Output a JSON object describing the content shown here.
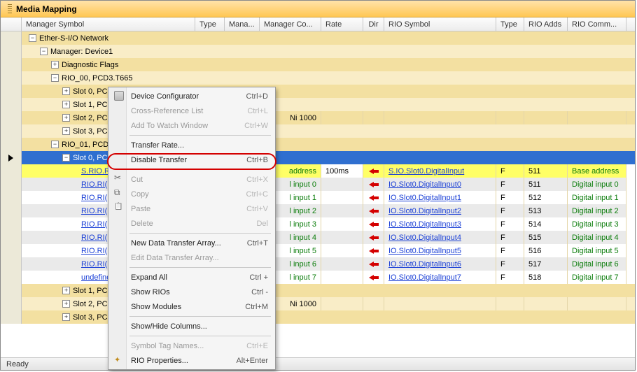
{
  "window": {
    "title": "Media Mapping"
  },
  "status": {
    "text": "Ready"
  },
  "columns": {
    "symbol": "Manager Symbol",
    "type": "Type",
    "mana": "Mana...",
    "mcomment": "Manager Co...",
    "rate": "Rate",
    "dir": "Dir",
    "rsymbol": "RIO Symbol",
    "rtype": "Type",
    "radds": "RIO Adds",
    "rcomment": "RIO Comm..."
  },
  "tree": {
    "root": "Ether-S-I/O Network",
    "manager": "Manager: Device1",
    "diag": "Diagnostic Flags",
    "rio00": "RIO_00, PCD3.T665",
    "rio00_slots": [
      "Slot 0, PCD3",
      "Slot 1, PCD3",
      "Slot 2, PCD3",
      "Slot 3, PCD3"
    ],
    "rio01": "RIO_01, PCD3",
    "rio01_slot0": "Slot 0, PCD3",
    "rio01_sub": [
      "S.RIO.RI(",
      "RIO.RI(",
      "RIO.RI(",
      "RIO.RI(",
      "RIO.RI(",
      "RIO.RI(",
      "RIO.RI(",
      "RIO.RI("
    ],
    "rio01_slots_rest": [
      "Slot 1, PCD3",
      "Slot 2, PCD3",
      "Slot 3, PCD3"
    ],
    "slot2_extra": "Ni 1000",
    "slot2_extra2": "Ni 1000"
  },
  "mapping": {
    "base": {
      "mcomment": "address",
      "rate": "100ms",
      "rsymbol": "S.IO.Slot0.DigitalInput",
      "rtype": "F",
      "radds": "511",
      "rcomment": "Base address"
    },
    "rows": [
      {
        "mcomment": "l input 0",
        "rsymbol": "IO.Slot0.DigitalInput0",
        "rtype": "F",
        "radds": "511",
        "rcomment": "Digital input 0"
      },
      {
        "mcomment": "l input 1",
        "rsymbol": "IO.Slot0.DigitalInput1",
        "rtype": "F",
        "radds": "512",
        "rcomment": "Digital input 1"
      },
      {
        "mcomment": "l input 2",
        "rsymbol": "IO.Slot0.DigitalInput2",
        "rtype": "F",
        "radds": "513",
        "rcomment": "Digital input 2"
      },
      {
        "mcomment": "l input 3",
        "rsymbol": "IO.Slot0.DigitalInput3",
        "rtype": "F",
        "radds": "514",
        "rcomment": "Digital input 3"
      },
      {
        "mcomment": "l input 4",
        "rsymbol": "IO.Slot0.DigitalInput4",
        "rtype": "F",
        "radds": "515",
        "rcomment": "Digital input 4"
      },
      {
        "mcomment": "l input 5",
        "rsymbol": "IO.Slot0.DigitalInput5",
        "rtype": "F",
        "radds": "516",
        "rcomment": "Digital input 5"
      },
      {
        "mcomment": "l input 6",
        "rsymbol": "IO.Slot0.DigitalInput6",
        "rtype": "F",
        "radds": "517",
        "rcomment": "Digital input 6"
      },
      {
        "mcomment": "l input 7",
        "rsymbol": "IO.Slot0.DigitalInput7",
        "rtype": "F",
        "radds": "518",
        "rcomment": "Digital input 7"
      }
    ]
  },
  "menu": {
    "items": [
      {
        "label": "Device Configurator",
        "shortcut": "Ctrl+D",
        "icon": "wrench"
      },
      {
        "label": "Cross-Reference List",
        "shortcut": "Ctrl+L",
        "disabled": true
      },
      {
        "label": "Add To Watch Window",
        "shortcut": "Ctrl+W",
        "disabled": true
      },
      {
        "sep": true
      },
      {
        "label": "Transfer Rate..."
      },
      {
        "label": "Disable Transfer",
        "shortcut": "Ctrl+B"
      },
      {
        "sep": true
      },
      {
        "label": "Cut",
        "shortcut": "Ctrl+X",
        "icon": "scis",
        "disabled": true
      },
      {
        "label": "Copy",
        "shortcut": "Ctrl+C",
        "icon": "copy",
        "disabled": true
      },
      {
        "label": "Paste",
        "shortcut": "Ctrl+V",
        "icon": "paste",
        "disabled": true
      },
      {
        "label": "Delete",
        "shortcut": "Del",
        "disabled": true
      },
      {
        "sep": true
      },
      {
        "label": "New Data Transfer Array...",
        "shortcut": "Ctrl+T"
      },
      {
        "label": "Edit Data Transfer Array...",
        "disabled": true
      },
      {
        "sep": true
      },
      {
        "label": "Expand All",
        "shortcut": "Ctrl +"
      },
      {
        "label": "Show RIOs",
        "shortcut": "Ctrl -"
      },
      {
        "label": "Show Modules",
        "shortcut": "Ctrl+M"
      },
      {
        "sep": true
      },
      {
        "label": "Show/Hide Columns..."
      },
      {
        "sep": true
      },
      {
        "label": "Symbol Tag Names...",
        "shortcut": "Ctrl+E",
        "disabled": true
      },
      {
        "label": "RIO Properties...",
        "shortcut": "Alt+Enter",
        "icon": "prop"
      }
    ]
  }
}
